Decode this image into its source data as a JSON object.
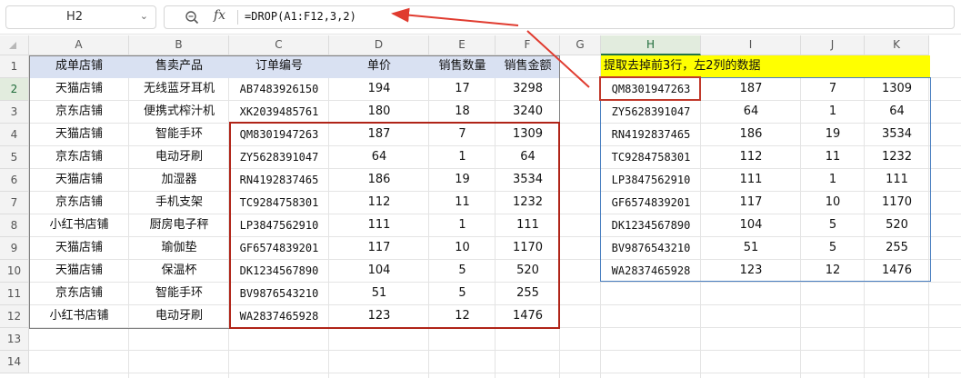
{
  "name_box": "H2",
  "formula": "=DROP(A1:F12,3,2)",
  "icons": {
    "zoom": "zoom-icon",
    "fx": "fx"
  },
  "columns": [
    "A",
    "B",
    "C",
    "D",
    "E",
    "F",
    "G",
    "H",
    "I",
    "J",
    "K"
  ],
  "rows": [
    "1",
    "2",
    "3",
    "4",
    "5",
    "6",
    "7",
    "8",
    "9",
    "10",
    "11",
    "12",
    "13",
    "14"
  ],
  "source": {
    "headers": [
      "成单店铺",
      "售卖产品",
      "订单编号",
      "单价",
      "销售数量",
      "销售金额"
    ],
    "data": [
      [
        "天猫店铺",
        "无线蓝牙耳机",
        "AB7483926150",
        "194",
        "17",
        "3298"
      ],
      [
        "京东店铺",
        "便携式榨汁机",
        "XK2039485761",
        "180",
        "18",
        "3240"
      ],
      [
        "天猫店铺",
        "智能手环",
        "QM8301947263",
        "187",
        "7",
        "1309"
      ],
      [
        "京东店铺",
        "电动牙刷",
        "ZY5628391047",
        "64",
        "1",
        "64"
      ],
      [
        "天猫店铺",
        "加湿器",
        "RN4192837465",
        "186",
        "19",
        "3534"
      ],
      [
        "京东店铺",
        "手机支架",
        "TC9284758301",
        "112",
        "11",
        "1232"
      ],
      [
        "小红书店铺",
        "厨房电子秤",
        "LP3847562910",
        "111",
        "1",
        "111"
      ],
      [
        "天猫店铺",
        "瑜伽垫",
        "GF6574839201",
        "117",
        "10",
        "1170"
      ],
      [
        "天猫店铺",
        "保温杯",
        "DK1234567890",
        "104",
        "5",
        "520"
      ],
      [
        "京东店铺",
        "智能手环",
        "BV9876543210",
        "51",
        "5",
        "255"
      ],
      [
        "小红书店铺",
        "电动牙刷",
        "WA2837465928",
        "123",
        "12",
        "1476"
      ]
    ]
  },
  "result": {
    "title": "提取去掉前3行，左2列的数据",
    "data": [
      [
        "QM8301947263",
        "187",
        "7",
        "1309"
      ],
      [
        "ZY5628391047",
        "64",
        "1",
        "64"
      ],
      [
        "RN4192837465",
        "186",
        "19",
        "3534"
      ],
      [
        "TC9284758301",
        "112",
        "11",
        "1232"
      ],
      [
        "LP3847562910",
        "111",
        "1",
        "111"
      ],
      [
        "GF6574839201",
        "117",
        "10",
        "1170"
      ],
      [
        "DK1234567890",
        "104",
        "5",
        "520"
      ],
      [
        "BV9876543210",
        "51",
        "5",
        "255"
      ],
      [
        "WA2837465928",
        "123",
        "12",
        "1476"
      ]
    ]
  },
  "colors": {
    "header_fill": "#d9e1f2",
    "banner_fill": "#ffff00",
    "highlight_red": "#b02418",
    "result_border": "#4a7fc0",
    "selected_header": "#217346"
  }
}
